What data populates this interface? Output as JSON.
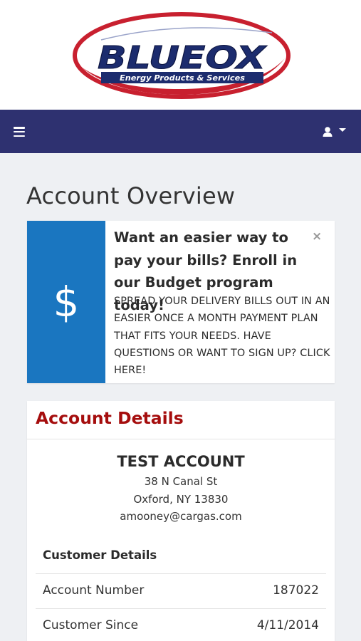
{
  "logo": {
    "brand": "BLUEOX",
    "tagline": "Energy Products & Services",
    "colors": {
      "oval": "#c8202f",
      "wordmark": "#1c2c6e"
    }
  },
  "navbar": {
    "menu_icon": "hamburger-icon",
    "user_icon": "user-icon",
    "dropdown_icon": "caret-down-icon",
    "color": "#2e3170"
  },
  "page": {
    "title": "Account Overview"
  },
  "promo": {
    "icon": "dollar-icon",
    "icon_glyph": "$",
    "close_glyph": "×",
    "heading": "Want an easier way to pay your bills? Enroll in our Budget program today!",
    "body": "SPREAD YOUR DELIVERY BILLS OUT IN AN EASIER ONCE A MONTH PAYMENT PLAN THAT FITS YOUR NEEDS. HAVE QUESTIONS OR WANT TO SIGN UP? CLICK HERE!",
    "accent": "#1a76c0"
  },
  "account_details": {
    "title": "Account Details",
    "title_color": "#a50d0d",
    "name": "TEST ACCOUNT",
    "address_line1": "38 N Canal St",
    "address_line2": "Oxford, NY 13830",
    "email": "amooney@cargas.com",
    "section_label": "Customer Details",
    "rows": [
      {
        "label": "Account Number",
        "value": "187022"
      },
      {
        "label": "Customer Since",
        "value": "4/11/2014"
      }
    ]
  }
}
